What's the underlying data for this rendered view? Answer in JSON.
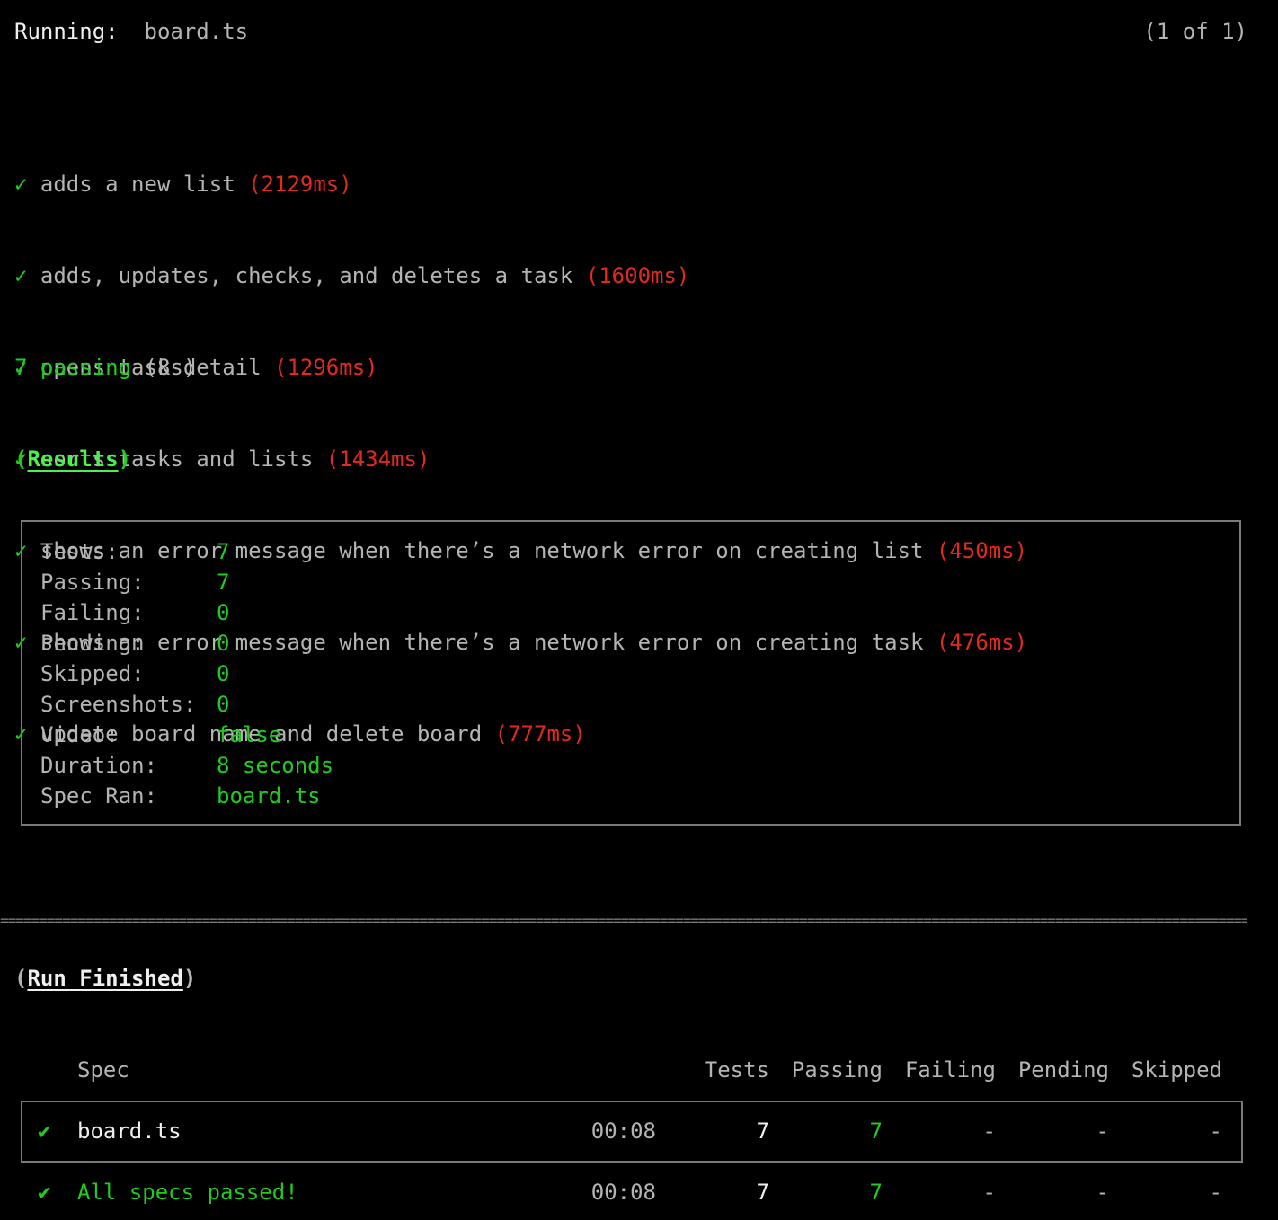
{
  "header": {
    "running_label": "Running:",
    "spec_name": "board.ts",
    "progress": "(1 of 1)"
  },
  "tests": [
    {
      "check": "✓",
      "title": "adds a new list",
      "duration": "(2129ms)"
    },
    {
      "check": "✓",
      "title": "adds, updates, checks, and deletes a task",
      "duration": "(1600ms)"
    },
    {
      "check": "✓",
      "title": "opens task detail",
      "duration": "(1296ms)"
    },
    {
      "check": "✓",
      "title": "sorts tasks and lists",
      "duration": "(1434ms)"
    },
    {
      "check": "✓",
      "title": "shows an error message when there’s a network error on creating list",
      "duration": "(450ms)"
    },
    {
      "check": "✓",
      "title": "shows an error message when there’s a network error on creating task",
      "duration": "(476ms)"
    },
    {
      "check": "✓",
      "title": "update board name and delete board",
      "duration": "(777ms)"
    }
  ],
  "summary": {
    "passing": "7 passing",
    "time": "(8s)"
  },
  "results": {
    "title": "Results",
    "stats": [
      {
        "label": "Tests:",
        "value": "7"
      },
      {
        "label": "Passing:",
        "value": "7"
      },
      {
        "label": "Failing:",
        "value": "0"
      },
      {
        "label": "Pending:",
        "value": "0"
      },
      {
        "label": "Skipped:",
        "value": "0"
      },
      {
        "label": "Screenshots:",
        "value": "0"
      },
      {
        "label": "Video:",
        "value": "false"
      },
      {
        "label": "Duration:",
        "value": "8 seconds"
      },
      {
        "label": "Spec Ran:",
        "value": "board.ts"
      }
    ]
  },
  "divider": "==================================================================================================================================================================================",
  "run_finished": {
    "title": "Run Finished",
    "columns": {
      "spec": "Spec",
      "tests": "Tests",
      "passing": "Passing",
      "failing": "Failing",
      "pending": "Pending",
      "skipped": "Skipped"
    },
    "rows": [
      {
        "check": "✔",
        "spec": "board.ts",
        "time": "00:08",
        "tests": "7",
        "passing": "7",
        "failing": "-",
        "pending": "-",
        "skipped": "-"
      }
    ],
    "total": {
      "check": "✔",
      "label": "All specs passed!",
      "time": "00:08",
      "tests": "7",
      "passing": "7",
      "failing": "-",
      "pending": "-",
      "skipped": "-"
    }
  },
  "colors": {
    "background": "#000000",
    "pass": "#1fcc1f",
    "duration": "#e12a1e",
    "muted": "#b4b4b4",
    "border": "#7a7a7a"
  }
}
